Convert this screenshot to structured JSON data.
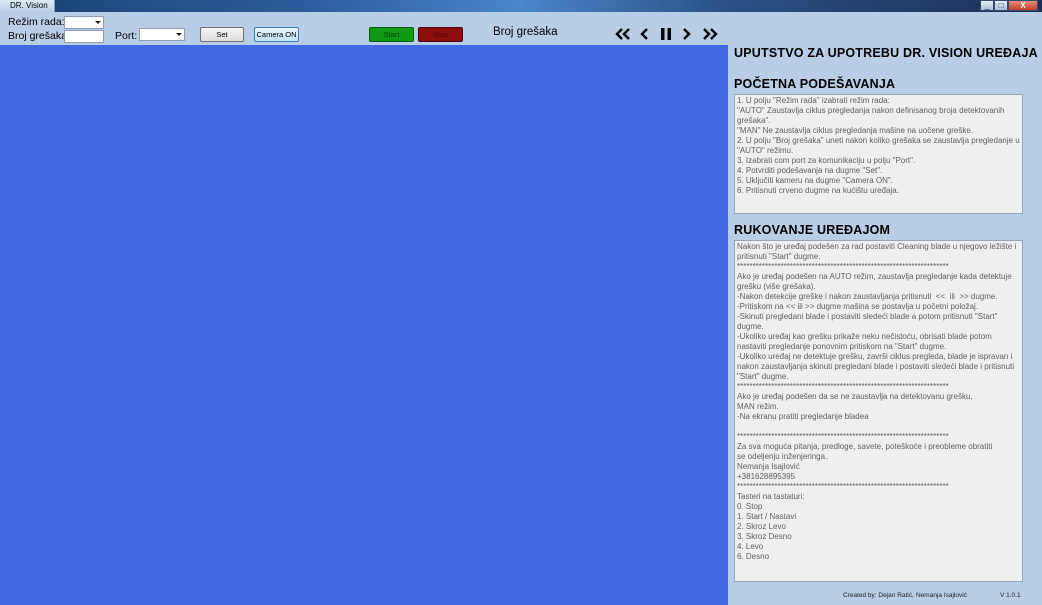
{
  "window": {
    "title": "DR. Vision",
    "btn_min": "_",
    "btn_max": "□",
    "btn_close": "X"
  },
  "toolbar": {
    "rezim_label": "Režim rada:",
    "greske_label": "Broj grešaka:",
    "port_label": "Port:",
    "set_label": "Set",
    "camera_label": "Camera ON",
    "start_label": "Start",
    "stop_label": "Stop",
    "error_count_label": "Broj grešaka"
  },
  "panel": {
    "main_title": "UPUTSTVO ZA UPOTREBU DR. VISION UREĐAJA",
    "section1_title": "POČETNA PODEŠAVANJA",
    "section1_lines": [
      "1. U polju \"Režim rada\" izabrati režim rada:",
      "\"AUTO\" Zaustavlja ciklus pregledanja nakon definisanog broja detektovanih grešaka\".",
      "\"MAN\" Ne zaustavlja ciklus pregledanja mašine na uočene greške.",
      "2. U polju \"Broj grešaka\" uneti nakon koliko grešaka se zaustavlja pregledanje u \"AUTO\" režimu.",
      "3. Izabrati com port za komunikaciju u polju \"Port\".",
      "4. Potvrditi podešavanja na dugme \"Set\".",
      "5. Uključiti kameru na dugme \"Camera ON\".",
      "6. Pritisnuti crveno dugme na kućištu uređaja."
    ],
    "section2_title": "RUKOVANJE UREĐAJOM",
    "section2_lines": [
      "Nakon što je uređaj podešen za rad postaviti Cleaning blade u njegovo ležište i pritisnuti \"Start\" dugme.",
      "********************************************************************",
      "Ako je uređaj podešen na AUTO režim, zaustavlja pregledanje kada detektuje grešku (više grešaka).",
      "-Nakon detekcije greške i nakon zaustavljanja pritisnuti  <<  ili  >> dugme.",
      "-Pritiskom na << ili >> dugme mašina se postavlja u početni položaj.",
      "-Skinuti pregledani blade i postaviti sledeći blade a potom pritisnuti \"Start\" dugme.",
      "-Ukoliko uređaj kao grešku prikaže neku nečistoću, obrisati blade potom nastaviti pregledanje ponovnim pritiskom na \"Start\" dugme.",
      "-Ukoliko uređaj ne detektuje grešku, završi ciklus pregleda, blade je ispravan i nakon zaustavljanja skinuti pregledani blade i postaviti sledeći blade i pritisnuti \"Start\" dugme.",
      "********************************************************************",
      "Ako je uređaj podešen da se ne zaustavlja na detektovanu grešku,",
      "MAN režim.",
      "-Na ekranu pratiti pregledanje bladea",
      "",
      "********************************************************************",
      "Za sva moguća pitanja, predloge, savete, poteškoće i preobleme obratiti",
      "se odeljenju inženjeringa.",
      "Nemanja Isajlović",
      "+381628895395",
      "********************************************************************",
      "Tasteri na tastaturi:",
      "0. Stop",
      "1. Start / Nastavi",
      "2. Skroz Levo",
      "3. Skroz Desno",
      "4. Levo",
      "6. Desno"
    ]
  },
  "footer": {
    "created_by": "Created by: Dejan Ratić,",
    "coauthor": "Nemanja Isajlović",
    "version": "V 1.0.1"
  },
  "colors": {
    "camera_bg": "#4169e1",
    "panel_bg": "#b8cde6",
    "start_btn": "#0e9a15",
    "stop_btn": "#8e0e0e"
  },
  "icons": [
    "rewind-icon",
    "step-back-icon",
    "pause-icon",
    "step-forward-icon",
    "fast-forward-icon"
  ]
}
